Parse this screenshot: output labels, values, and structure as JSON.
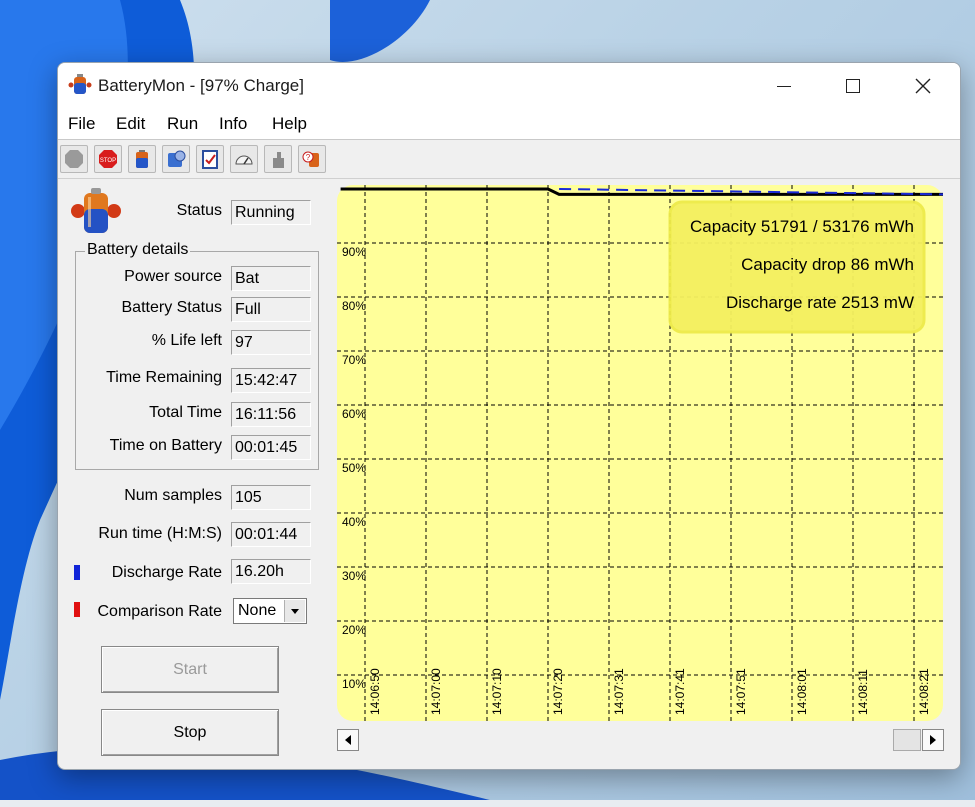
{
  "window": {
    "title": "BatteryMon - [97% Charge]"
  },
  "menu": [
    "File",
    "Edit",
    "Run",
    "Info",
    "Help"
  ],
  "toolbar": {
    "buttons": [
      "record-icon",
      "stop-icon",
      "battery-icon",
      "settings-icon",
      "checklist-icon",
      "gauge-icon",
      "hand-icon",
      "help-icon"
    ]
  },
  "status": {
    "label": "Status",
    "value": "Running"
  },
  "battery_details": {
    "title": "Battery details",
    "power_source": {
      "label": "Power source",
      "value": "Bat"
    },
    "battery_status": {
      "label": "Battery Status",
      "value": "Full"
    },
    "life_left": {
      "label": "% Life left",
      "value": "97"
    },
    "time_remaining": {
      "label": "Time Remaining",
      "value": "15:42:47"
    },
    "total_time": {
      "label": "Total Time",
      "value": "16:11:56"
    },
    "time_on_battery": {
      "label": "Time on Battery",
      "value": "00:01:45"
    }
  },
  "num_samples": {
    "label": "Num samples",
    "value": "105"
  },
  "run_time": {
    "label": "Run time (H:M:S)",
    "value": "00:01:44"
  },
  "discharge_rate": {
    "label": "Discharge Rate",
    "value": "16.20h",
    "color": "#1024d8"
  },
  "comparison_rate": {
    "label": "Comparison Rate",
    "value": "None",
    "color": "#e01010"
  },
  "buttons": {
    "start": "Start",
    "stop": "Stop"
  },
  "chart_data": {
    "type": "line",
    "y_ticks": [
      "90%",
      "80%",
      "70%",
      "60%",
      "50%",
      "40%",
      "30%",
      "20%",
      "10%"
    ],
    "x_ticks": [
      "14:06:50",
      "14:07:00",
      "14:07:10",
      "14:07:20",
      "14:07:31",
      "14:07:41",
      "14:07:51",
      "14:08:01",
      "14:08:11",
      "14:08:21"
    ],
    "ylim": [
      0,
      100
    ],
    "grid": true,
    "background": "#ffff9a",
    "series": [
      {
        "color": "#000000",
        "style": "solid",
        "points": [
          [
            "14:06:46",
            100
          ],
          [
            "14:07:20",
            100
          ],
          [
            "14:07:22",
            99
          ],
          [
            "14:08:26",
            99
          ]
        ]
      },
      {
        "color": "#1a2ad8",
        "style": "dashed",
        "points": [
          [
            "14:07:22",
            100
          ],
          [
            "14:08:26",
            99
          ]
        ]
      }
    ],
    "info_box": {
      "placement": "top-right",
      "lines": [
        "Capacity 51791 / 53176 mWh",
        "Capacity drop 86 mWh",
        "Discharge rate 2513 mW"
      ]
    }
  }
}
